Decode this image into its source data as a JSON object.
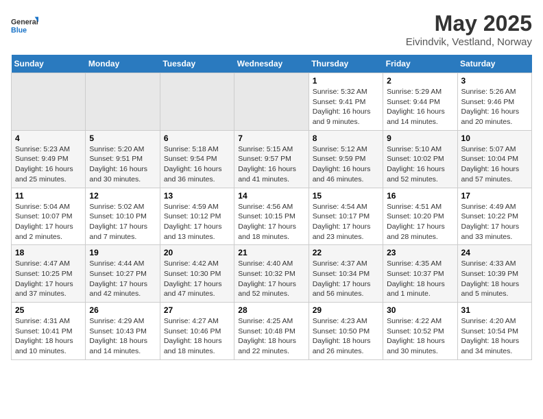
{
  "header": {
    "logo_general": "General",
    "logo_blue": "Blue",
    "title": "May 2025",
    "subtitle": "Eivindvik, Vestland, Norway"
  },
  "weekdays": [
    "Sunday",
    "Monday",
    "Tuesday",
    "Wednesday",
    "Thursday",
    "Friday",
    "Saturday"
  ],
  "weeks": [
    [
      {
        "day": "",
        "info": ""
      },
      {
        "day": "",
        "info": ""
      },
      {
        "day": "",
        "info": ""
      },
      {
        "day": "",
        "info": ""
      },
      {
        "day": "1",
        "info": "Sunrise: 5:32 AM\nSunset: 9:41 PM\nDaylight: 16 hours\nand 9 minutes."
      },
      {
        "day": "2",
        "info": "Sunrise: 5:29 AM\nSunset: 9:44 PM\nDaylight: 16 hours\nand 14 minutes."
      },
      {
        "day": "3",
        "info": "Sunrise: 5:26 AM\nSunset: 9:46 PM\nDaylight: 16 hours\nand 20 minutes."
      }
    ],
    [
      {
        "day": "4",
        "info": "Sunrise: 5:23 AM\nSunset: 9:49 PM\nDaylight: 16 hours\nand 25 minutes."
      },
      {
        "day": "5",
        "info": "Sunrise: 5:20 AM\nSunset: 9:51 PM\nDaylight: 16 hours\nand 30 minutes."
      },
      {
        "day": "6",
        "info": "Sunrise: 5:18 AM\nSunset: 9:54 PM\nDaylight: 16 hours\nand 36 minutes."
      },
      {
        "day": "7",
        "info": "Sunrise: 5:15 AM\nSunset: 9:57 PM\nDaylight: 16 hours\nand 41 minutes."
      },
      {
        "day": "8",
        "info": "Sunrise: 5:12 AM\nSunset: 9:59 PM\nDaylight: 16 hours\nand 46 minutes."
      },
      {
        "day": "9",
        "info": "Sunrise: 5:10 AM\nSunset: 10:02 PM\nDaylight: 16 hours\nand 52 minutes."
      },
      {
        "day": "10",
        "info": "Sunrise: 5:07 AM\nSunset: 10:04 PM\nDaylight: 16 hours\nand 57 minutes."
      }
    ],
    [
      {
        "day": "11",
        "info": "Sunrise: 5:04 AM\nSunset: 10:07 PM\nDaylight: 17 hours\nand 2 minutes."
      },
      {
        "day": "12",
        "info": "Sunrise: 5:02 AM\nSunset: 10:10 PM\nDaylight: 17 hours\nand 7 minutes."
      },
      {
        "day": "13",
        "info": "Sunrise: 4:59 AM\nSunset: 10:12 PM\nDaylight: 17 hours\nand 13 minutes."
      },
      {
        "day": "14",
        "info": "Sunrise: 4:56 AM\nSunset: 10:15 PM\nDaylight: 17 hours\nand 18 minutes."
      },
      {
        "day": "15",
        "info": "Sunrise: 4:54 AM\nSunset: 10:17 PM\nDaylight: 17 hours\nand 23 minutes."
      },
      {
        "day": "16",
        "info": "Sunrise: 4:51 AM\nSunset: 10:20 PM\nDaylight: 17 hours\nand 28 minutes."
      },
      {
        "day": "17",
        "info": "Sunrise: 4:49 AM\nSunset: 10:22 PM\nDaylight: 17 hours\nand 33 minutes."
      }
    ],
    [
      {
        "day": "18",
        "info": "Sunrise: 4:47 AM\nSunset: 10:25 PM\nDaylight: 17 hours\nand 37 minutes."
      },
      {
        "day": "19",
        "info": "Sunrise: 4:44 AM\nSunset: 10:27 PM\nDaylight: 17 hours\nand 42 minutes."
      },
      {
        "day": "20",
        "info": "Sunrise: 4:42 AM\nSunset: 10:30 PM\nDaylight: 17 hours\nand 47 minutes."
      },
      {
        "day": "21",
        "info": "Sunrise: 4:40 AM\nSunset: 10:32 PM\nDaylight: 17 hours\nand 52 minutes."
      },
      {
        "day": "22",
        "info": "Sunrise: 4:37 AM\nSunset: 10:34 PM\nDaylight: 17 hours\nand 56 minutes."
      },
      {
        "day": "23",
        "info": "Sunrise: 4:35 AM\nSunset: 10:37 PM\nDaylight: 18 hours\nand 1 minute."
      },
      {
        "day": "24",
        "info": "Sunrise: 4:33 AM\nSunset: 10:39 PM\nDaylight: 18 hours\nand 5 minutes."
      }
    ],
    [
      {
        "day": "25",
        "info": "Sunrise: 4:31 AM\nSunset: 10:41 PM\nDaylight: 18 hours\nand 10 minutes."
      },
      {
        "day": "26",
        "info": "Sunrise: 4:29 AM\nSunset: 10:43 PM\nDaylight: 18 hours\nand 14 minutes."
      },
      {
        "day": "27",
        "info": "Sunrise: 4:27 AM\nSunset: 10:46 PM\nDaylight: 18 hours\nand 18 minutes."
      },
      {
        "day": "28",
        "info": "Sunrise: 4:25 AM\nSunset: 10:48 PM\nDaylight: 18 hours\nand 22 minutes."
      },
      {
        "day": "29",
        "info": "Sunrise: 4:23 AM\nSunset: 10:50 PM\nDaylight: 18 hours\nand 26 minutes."
      },
      {
        "day": "30",
        "info": "Sunrise: 4:22 AM\nSunset: 10:52 PM\nDaylight: 18 hours\nand 30 minutes."
      },
      {
        "day": "31",
        "info": "Sunrise: 4:20 AM\nSunset: 10:54 PM\nDaylight: 18 hours\nand 34 minutes."
      }
    ]
  ]
}
